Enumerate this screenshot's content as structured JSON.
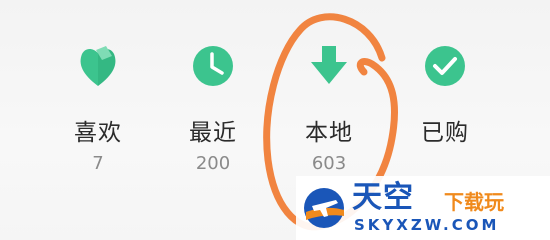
{
  "nav": {
    "items": [
      {
        "label": "喜欢",
        "count": "7",
        "icon": "heart-leaf-icon"
      },
      {
        "label": "最近",
        "count": "200",
        "icon": "clock-icon"
      },
      {
        "label": "本地",
        "count": "603",
        "icon": "download-arrow-icon"
      },
      {
        "label": "已购",
        "count": "",
        "icon": "check-circle-icon"
      }
    ],
    "accent_color": "#3cc48e"
  },
  "watermark": {
    "brand": "天空",
    "tagline": "下载玩",
    "url": "SKYXZW.COM"
  }
}
